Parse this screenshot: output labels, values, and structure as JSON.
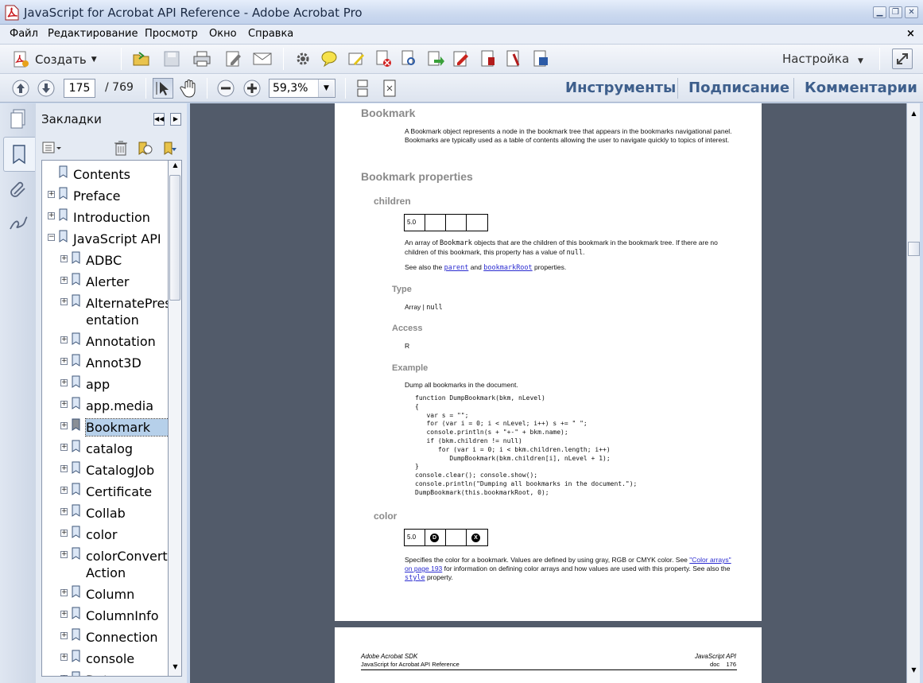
{
  "window": {
    "title": "JavaScript for Acrobat  API Reference - Adobe Acrobat Pro",
    "controls": [
      "minimize",
      "restore",
      "close"
    ]
  },
  "menubar": {
    "items": [
      "Файл",
      "Редактирование",
      "Просмотр",
      "Окно",
      "Справка"
    ],
    "close": "×"
  },
  "toolbar": {
    "create_label": "Создать",
    "settings_label": "Настройка",
    "page_current": "175",
    "page_total": "/ 769",
    "zoom": "59,3%",
    "right_tabs": [
      "Инструменты",
      "Подписание",
      "Комментарии"
    ]
  },
  "nav_panel": {
    "title": "Закладки",
    "items": [
      {
        "label": "Contents",
        "level": 0,
        "expander": ""
      },
      {
        "label": "Preface",
        "level": 0,
        "expander": "+"
      },
      {
        "label": "Introduction",
        "level": 0,
        "expander": "+"
      },
      {
        "label": "JavaScript API",
        "level": 0,
        "expander": "−"
      },
      {
        "label": "ADBC",
        "level": 1,
        "expander": "+"
      },
      {
        "label": "Alerter",
        "level": 1,
        "expander": "+"
      },
      {
        "label": "AlternatePres",
        "label2": "entation",
        "level": 1,
        "expander": "+"
      },
      {
        "label": "Annotation",
        "level": 1,
        "expander": "+"
      },
      {
        "label": "Annot3D",
        "level": 1,
        "expander": "+"
      },
      {
        "label": "app",
        "level": 1,
        "expander": "+"
      },
      {
        "label": "app.media",
        "level": 1,
        "expander": "+"
      },
      {
        "label": "Bookmark",
        "level": 1,
        "expander": "+",
        "selected": true
      },
      {
        "label": "catalog",
        "level": 1,
        "expander": "+"
      },
      {
        "label": "CatalogJob",
        "level": 1,
        "expander": "+"
      },
      {
        "label": "Certificate",
        "level": 1,
        "expander": "+"
      },
      {
        "label": "Collab",
        "level": 1,
        "expander": "+"
      },
      {
        "label": "color",
        "level": 1,
        "expander": "+"
      },
      {
        "label": "colorConvert",
        "label2": "Action",
        "level": 1,
        "expander": "+"
      },
      {
        "label": "Column",
        "level": 1,
        "expander": "+"
      },
      {
        "label": "ColumnInfo",
        "level": 1,
        "expander": "+"
      },
      {
        "label": "Connection",
        "level": 1,
        "expander": "+"
      },
      {
        "label": "console",
        "level": 1,
        "expander": "+"
      },
      {
        "label": "Data",
        "level": 1,
        "expander": "+"
      }
    ]
  },
  "document": {
    "heading": "Bookmark",
    "intro": "A Bookmark object represents a node in the bookmark tree that appears in the bookmarks navigational panel. Bookmarks are typically used as a table of contents allowing the user to navigate quickly to topics of interest.",
    "properties_heading": "Bookmark properties",
    "children": {
      "name": "children",
      "version_table": [
        "5.0",
        "",
        "",
        ""
      ],
      "desc_a": "An array of ",
      "desc_code1": "Bookmark",
      "desc_b": " objects that are the children of this bookmark in the bookmark tree. If there are no children of this bookmark, this property has a value of ",
      "desc_code2": "null",
      "desc_c": ".",
      "see_a": "See also the ",
      "see_link1": "parent",
      "see_and": " and ",
      "see_link2": "bookmarkRoot",
      "see_b": " properties.",
      "type_label": "Type",
      "type_value_a": "Array | ",
      "type_value_code": "null",
      "access_label": "Access",
      "access_value": "R",
      "example_label": "Example",
      "example_desc": "Dump all bookmarks in the document.",
      "code": "function DumpBookmark(bkm, nLevel)\n{\n   var s = \"\";\n   for (var i = 0; i < nLevel; i++) s += \" \";\n   console.println(s + \"+-\" + bkm.name);\n   if (bkm.children != null)\n      for (var i = 0; i < bkm.children.length; i++)\n         DumpBookmark(bkm.children[i], nLevel + 1);\n}\nconsole.clear(); console.show();\nconsole.println(\"Dumping all bookmarks in the document.\");\nDumpBookmark(this.bookmarkRoot, 0);"
    },
    "color": {
      "name": "color",
      "version_table": [
        "5.0",
        "D",
        "",
        "X"
      ],
      "desc_a": "Specifies the color for a bookmark. Values are defined by using gray, RGB or CMYK color. See ",
      "desc_link": "\"Color arrays\" on page 193",
      "desc_b": " for information on defining color arrays and how values are used with this property. See also the ",
      "desc_code": "style",
      "desc_c": " property."
    },
    "footer": {
      "left1": "Adobe Acrobat SDK",
      "left2": "JavaScript for Acrobat API Reference",
      "right1": "JavaScript API",
      "right2": "doc    176"
    }
  },
  "colors": {
    "accent_tabs": "#3e5f8c",
    "doc_background": "#525b6a",
    "selection": "#b6d0ea"
  }
}
